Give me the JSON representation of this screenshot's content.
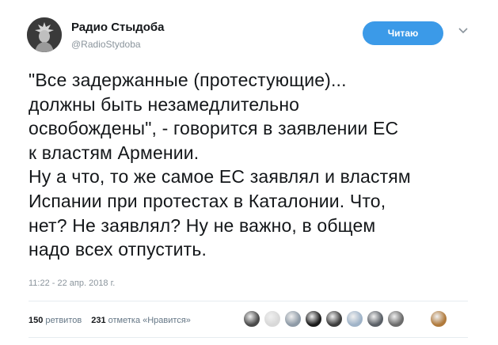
{
  "author": {
    "name": "Радио Стыдоба",
    "handle": "@RadioStydoba",
    "avatar_icon": "statue-avatar-icon"
  },
  "follow_button": {
    "label": "Читаю",
    "color": "#3b9ae8"
  },
  "menu_icon": "chevron-down-icon",
  "tweet": {
    "text": "\"Все задержанные (протестующие)...\nдолжны быть незамедлительно\nосвобождены\", - говорится в заявлении ЕС\nк властям Армении.\nНу а что, то же самое ЕС заявлял и властям\nИспании при протестах в Каталонии. Что,\nнет? Не заявлял? Ну не важно, в общем\nнадо всех отпустить.",
    "timestamp": "11:22 - 22 апр. 2018 г."
  },
  "stats": {
    "retweets_count": "150",
    "retweets_label": "ретвитов",
    "likes_count": "231",
    "likes_label": "отметка «Нравится»"
  },
  "liker_avatars": [
    {
      "name": "liker-avatar-1",
      "color": "#4a4a4a"
    },
    {
      "name": "liker-avatar-2",
      "color": "#d8d8d8"
    },
    {
      "name": "liker-avatar-3",
      "color": "#8e9aa6"
    },
    {
      "name": "liker-avatar-4",
      "color": "#1a1a1a"
    },
    {
      "name": "liker-avatar-5",
      "color": "#3d3d3d"
    },
    {
      "name": "liker-avatar-6",
      "color": "#9fb3c8"
    },
    {
      "name": "liker-avatar-7",
      "color": "#5a5f66"
    },
    {
      "name": "liker-avatar-8",
      "color": "#6b6b6b"
    },
    {
      "name": "liker-avatar-9",
      "color": "#b07a3c"
    }
  ]
}
